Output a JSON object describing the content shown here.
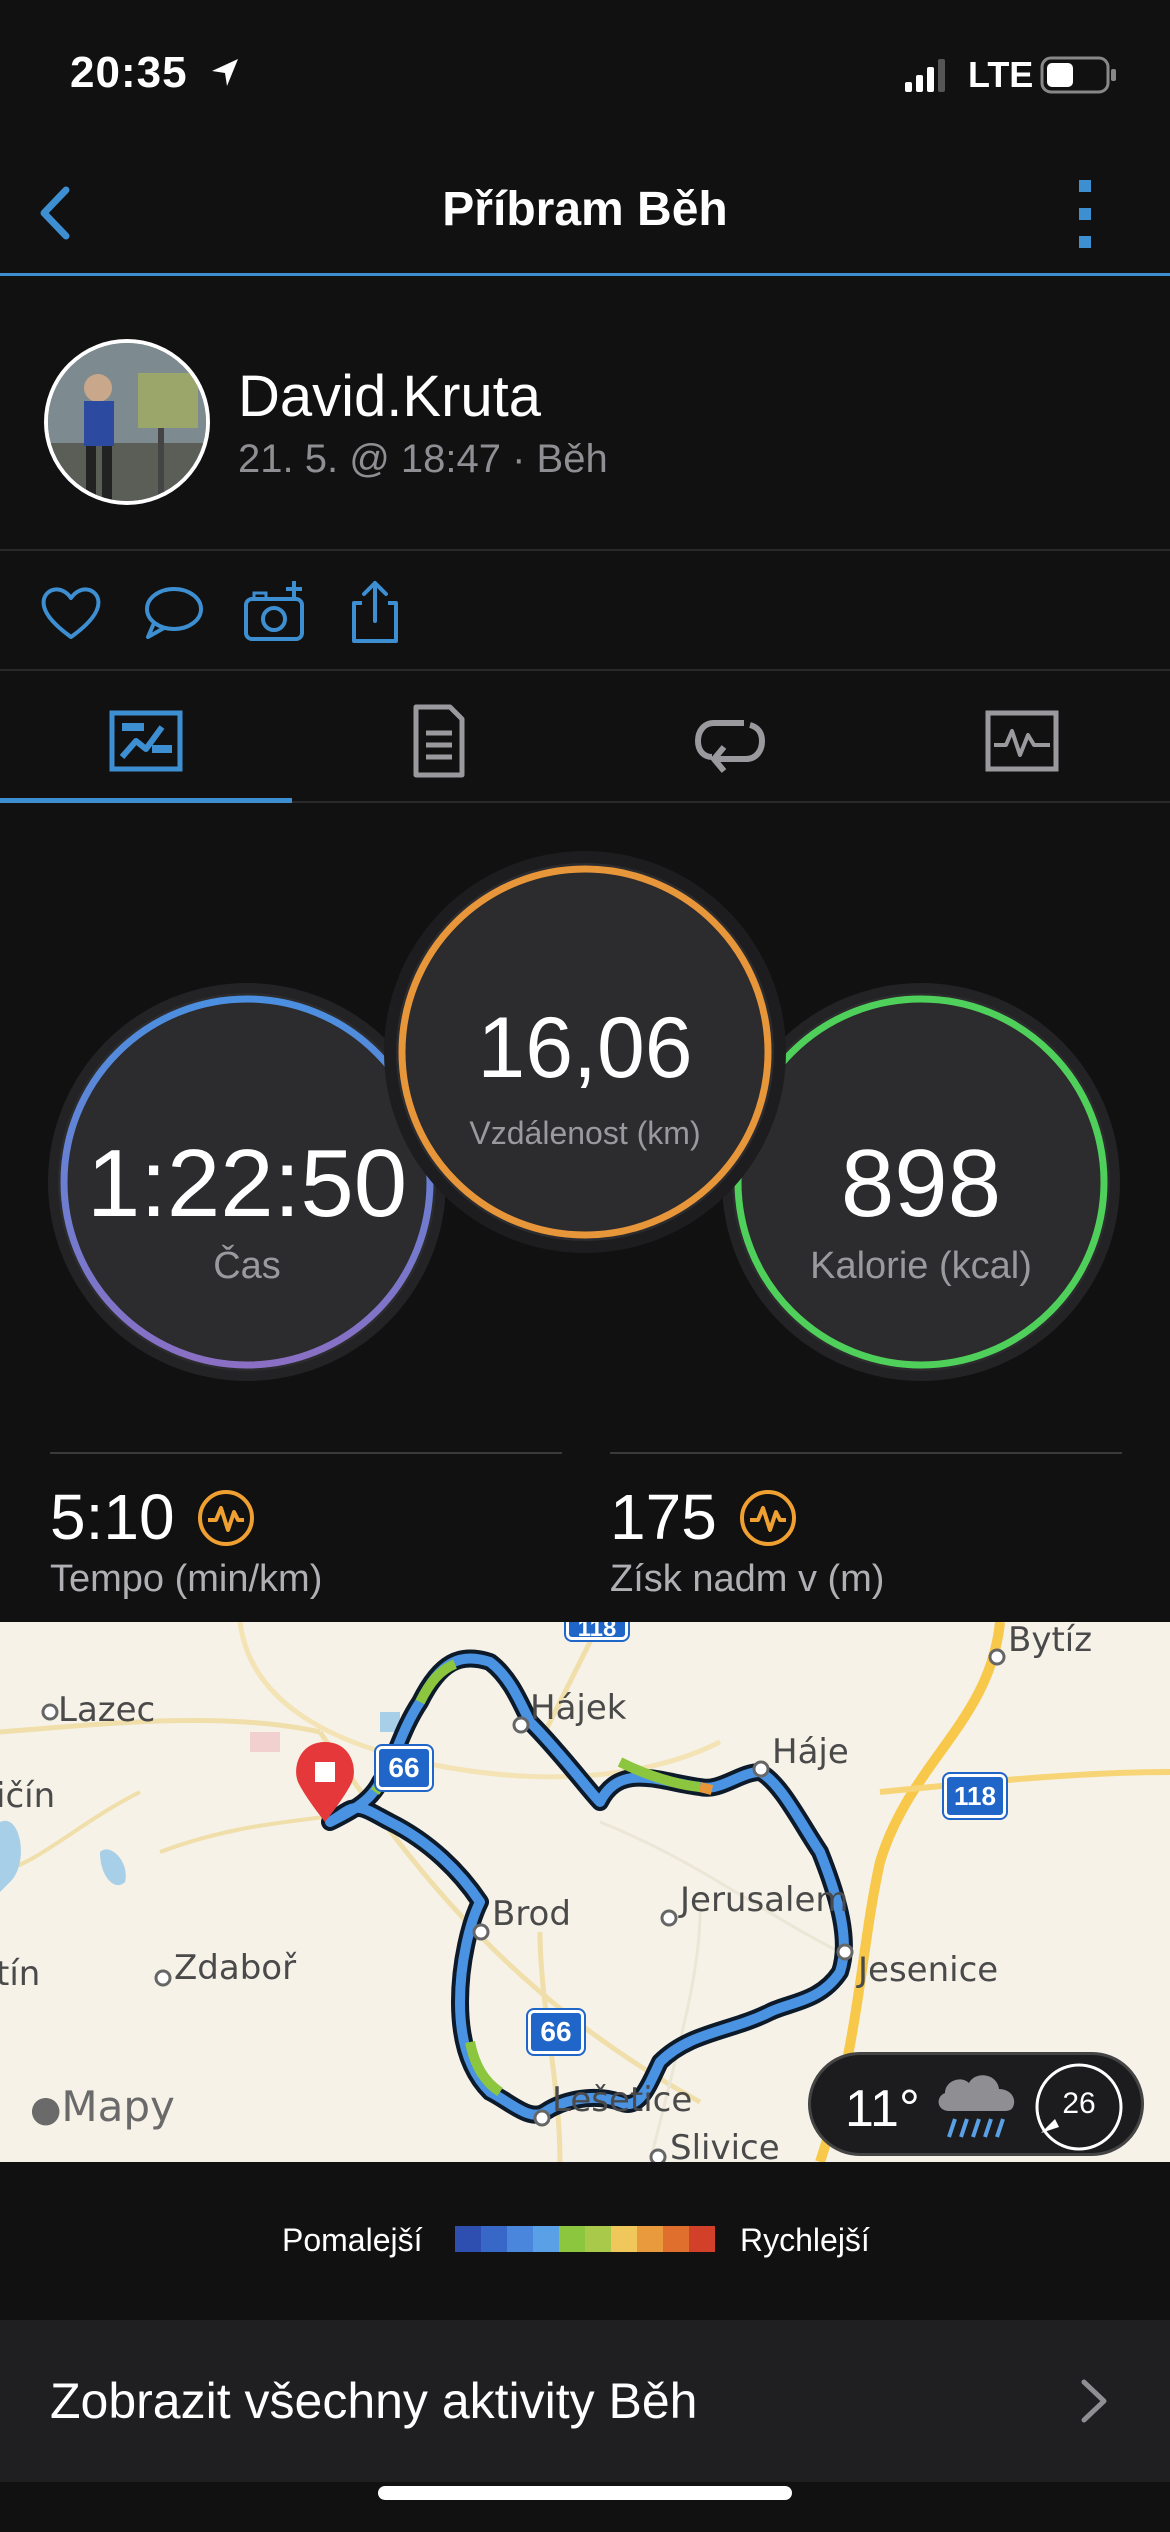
{
  "status_bar": {
    "time": "20:35",
    "network": "LTE"
  },
  "nav": {
    "title": "Příbram Běh"
  },
  "profile": {
    "username": "David.Kruta",
    "meta": "21. 5. @ 18:47 · Běh"
  },
  "stats": {
    "time": {
      "value": "1:22:50",
      "label": "Čas"
    },
    "distance": {
      "value": "16,06",
      "label": "Vzdálenost (km)"
    },
    "calories": {
      "value": "898",
      "label": "Kalorie (kcal)"
    },
    "pace": {
      "value": "5:10",
      "label": "Tempo (min/km)"
    },
    "elevation": {
      "value": "175",
      "label": "Získ nadm v (m)"
    }
  },
  "map": {
    "places": {
      "lazec": "Lazec",
      "cicin": "ičín",
      "tin": "tín",
      "zdabor": "Zdaboř",
      "hajek": "Hájek",
      "haje": "Háje",
      "bytiz": "Bytíz",
      "brod": "Brod",
      "jerusalem": "Jerusalem",
      "jesenice": "Jesenice",
      "lesetice": "Lešetice",
      "slivice": "Slivice"
    },
    "roads": {
      "r66a": "66",
      "r66b": "66",
      "r118": "118",
      "r118top": "118"
    },
    "logo": "Mapy",
    "weather": {
      "temp": "11°",
      "wind": "26"
    }
  },
  "legend": {
    "slower": "Pomalejší",
    "faster": "Rychlejší",
    "colors": [
      "#2e4fb0",
      "#3767c7",
      "#4a86dc",
      "#5aa0e6",
      "#8cc63f",
      "#a9c94a",
      "#f0c75a",
      "#e89a3c",
      "#e06f2e",
      "#d2402a"
    ]
  },
  "footer": {
    "all_activities": "Zobrazit všechny aktivity Běh"
  },
  "colors": {
    "accent": "#3d8fd1",
    "time_ring": "#5a8fd8",
    "distance_ring": "#e8963a",
    "calories_ring": "#4fd05a",
    "icon_orange": "#f0a030"
  }
}
